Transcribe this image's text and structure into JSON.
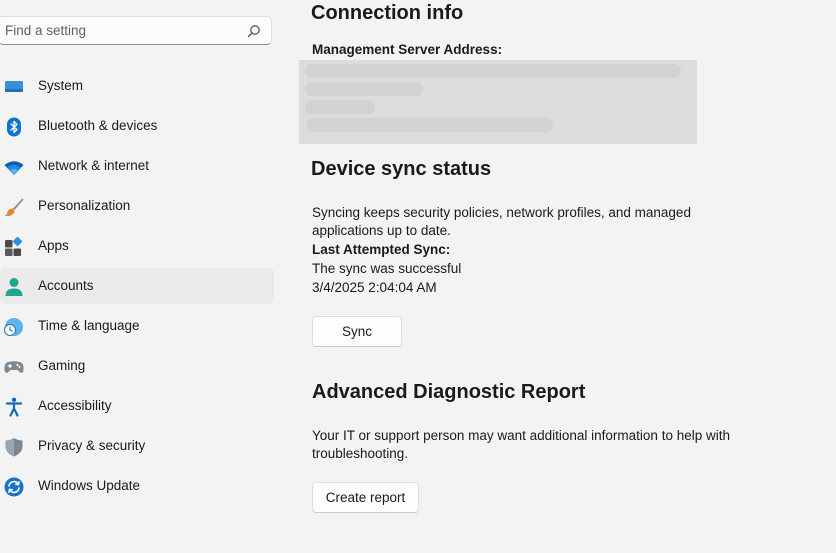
{
  "search": {
    "placeholder": "Find a setting",
    "icon": "search-icon"
  },
  "sidebar": {
    "items": [
      {
        "label": "System",
        "icon": "system-monitor-icon",
        "active": false
      },
      {
        "label": "Bluetooth & devices",
        "icon": "bluetooth-icon",
        "active": false
      },
      {
        "label": "Network & internet",
        "icon": "wifi-icon",
        "active": false
      },
      {
        "label": "Personalization",
        "icon": "paintbrush-icon",
        "active": false
      },
      {
        "label": "Apps",
        "icon": "apps-grid-icon",
        "active": false
      },
      {
        "label": "Accounts",
        "icon": "person-icon",
        "active": true
      },
      {
        "label": "Time & language",
        "icon": "globe-clock-icon",
        "active": false
      },
      {
        "label": "Gaming",
        "icon": "gamepad-icon",
        "active": false
      },
      {
        "label": "Accessibility",
        "icon": "accessibility-icon",
        "active": false
      },
      {
        "label": "Privacy & security",
        "icon": "shield-icon",
        "active": false
      },
      {
        "label": "Windows Update",
        "icon": "update-sync-icon",
        "active": false
      }
    ]
  },
  "connection_info": {
    "heading": "Connection info",
    "server_label": "Management Server Address:"
  },
  "device_sync": {
    "heading": "Device sync status",
    "description_line1": "Syncing keeps security policies, network profiles, and managed",
    "description_line2": "applications up to date.",
    "last_sync_label": "Last Attempted Sync:",
    "sync_result": "The sync was successful",
    "sync_time": "3/4/2025 2:04:04 AM",
    "sync_button": "Sync"
  },
  "diagnostic": {
    "heading": "Advanced Diagnostic Report",
    "description_line1": "Your IT or support person may want additional information to help with",
    "description_line2": "troubleshooting.",
    "create_button": "Create report"
  },
  "colors": {
    "background": "#f3f3f3",
    "active_item": "#eaeaea",
    "accent": "#0067c0"
  }
}
